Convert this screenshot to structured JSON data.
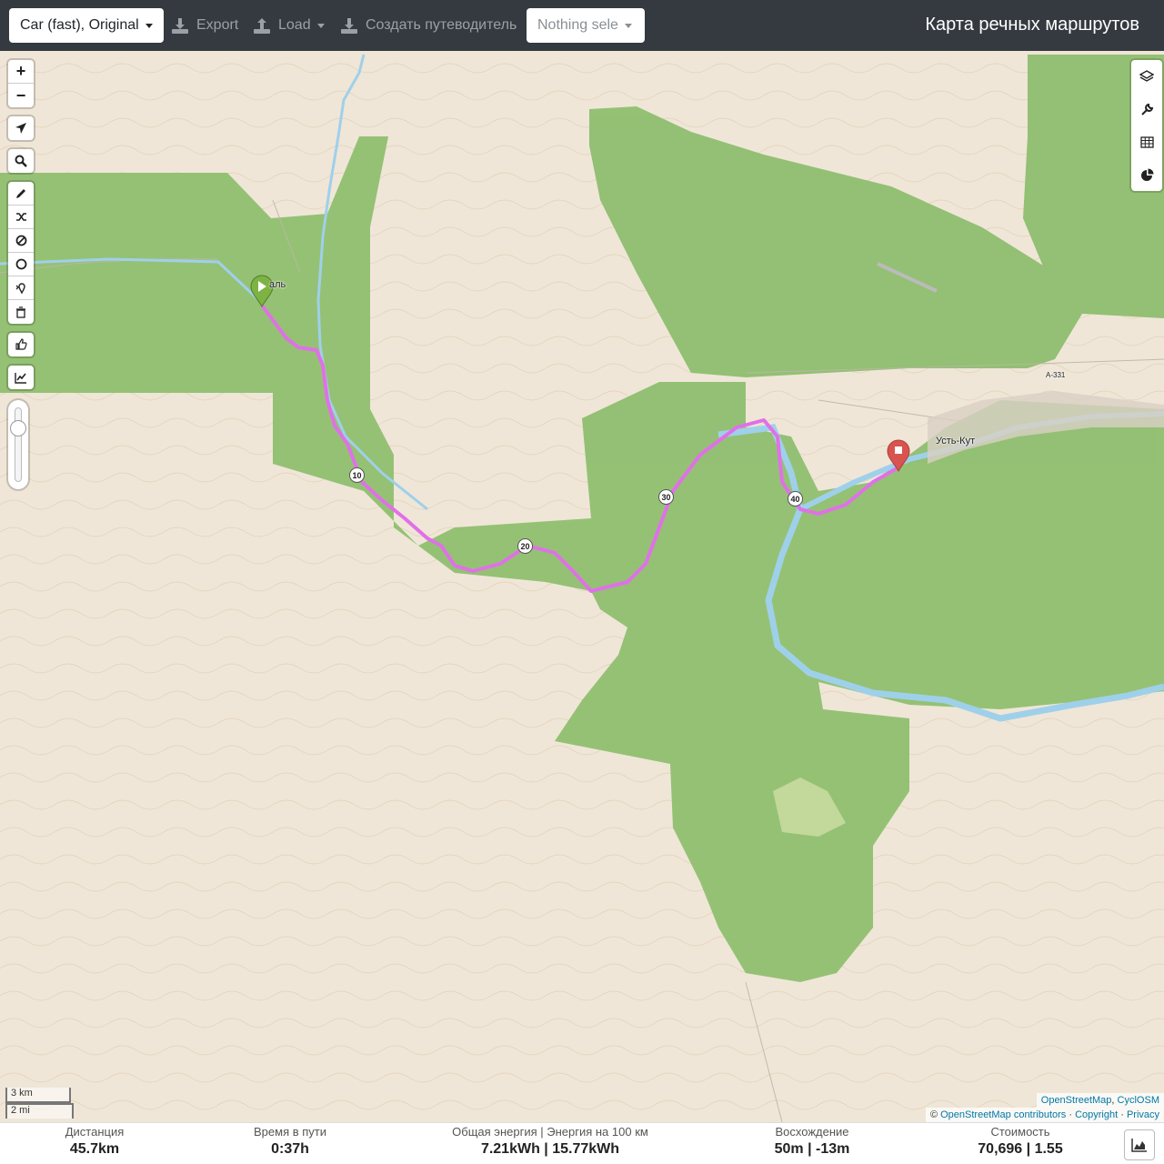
{
  "navbar": {
    "profile_select": "Car (fast), Original",
    "export_label": "Export",
    "load_label": "Load",
    "guide_label": "Создать путеводитель",
    "selection_placeholder": "Nothing sele",
    "title": "Карта речных маршрутов"
  },
  "map": {
    "place_start": "Усть-Кут",
    "place_start_partial": "аль",
    "road_label": "А-331",
    "distance_markers": [
      "10",
      "20",
      "30",
      "40"
    ],
    "start_marker_icon": "play-icon",
    "end_marker_icon": "stop-icon",
    "colors": {
      "forest": "#8fbf6f",
      "land": "#efe6d8",
      "river": "#9fd0ea",
      "route": "#e070e8",
      "start_marker": "#7cb342",
      "end_marker": "#d9534f"
    }
  },
  "controls": {
    "zoom_in": "+",
    "zoom_out": "−",
    "left_tools": [
      "locate-icon",
      "search-icon",
      "draw-icon",
      "shuffle-icon",
      "nogo-icon",
      "circle-icon",
      "poi-icon",
      "delete-icon",
      "thumb-icon",
      "elevation-icon"
    ],
    "right_tools": [
      "layers-icon",
      "settings-icon",
      "table-icon",
      "pie-chart-icon"
    ]
  },
  "scale": {
    "metric": "3 km",
    "imperial": "2 mi"
  },
  "attribution": {
    "layer_osm": "OpenStreetMap",
    "layer_cyclosm": "CyclOSM",
    "copyright_prefix": "©",
    "osm_contributors": "OpenStreetMap contributors",
    "copyright": "Copyright",
    "privacy": "Privacy"
  },
  "stats": {
    "distance": {
      "label": "Дистанция",
      "value": "45.7",
      "unit": "km"
    },
    "time": {
      "label": "Время в пути",
      "value": "0:37",
      "unit": "h"
    },
    "energy": {
      "label": "Общая энергия",
      "label2": "Энергия на 100 км",
      "value": "7.21",
      "unit": "kWh",
      "value2": "15.77",
      "unit2": "kWh"
    },
    "ascent": {
      "label": "Восхождение",
      "value": "50",
      "unit": "m",
      "value2": "-13",
      "unit2": "m"
    },
    "cost": {
      "label": "Стоимость",
      "value": "70,696",
      "value2": "1.55"
    }
  }
}
